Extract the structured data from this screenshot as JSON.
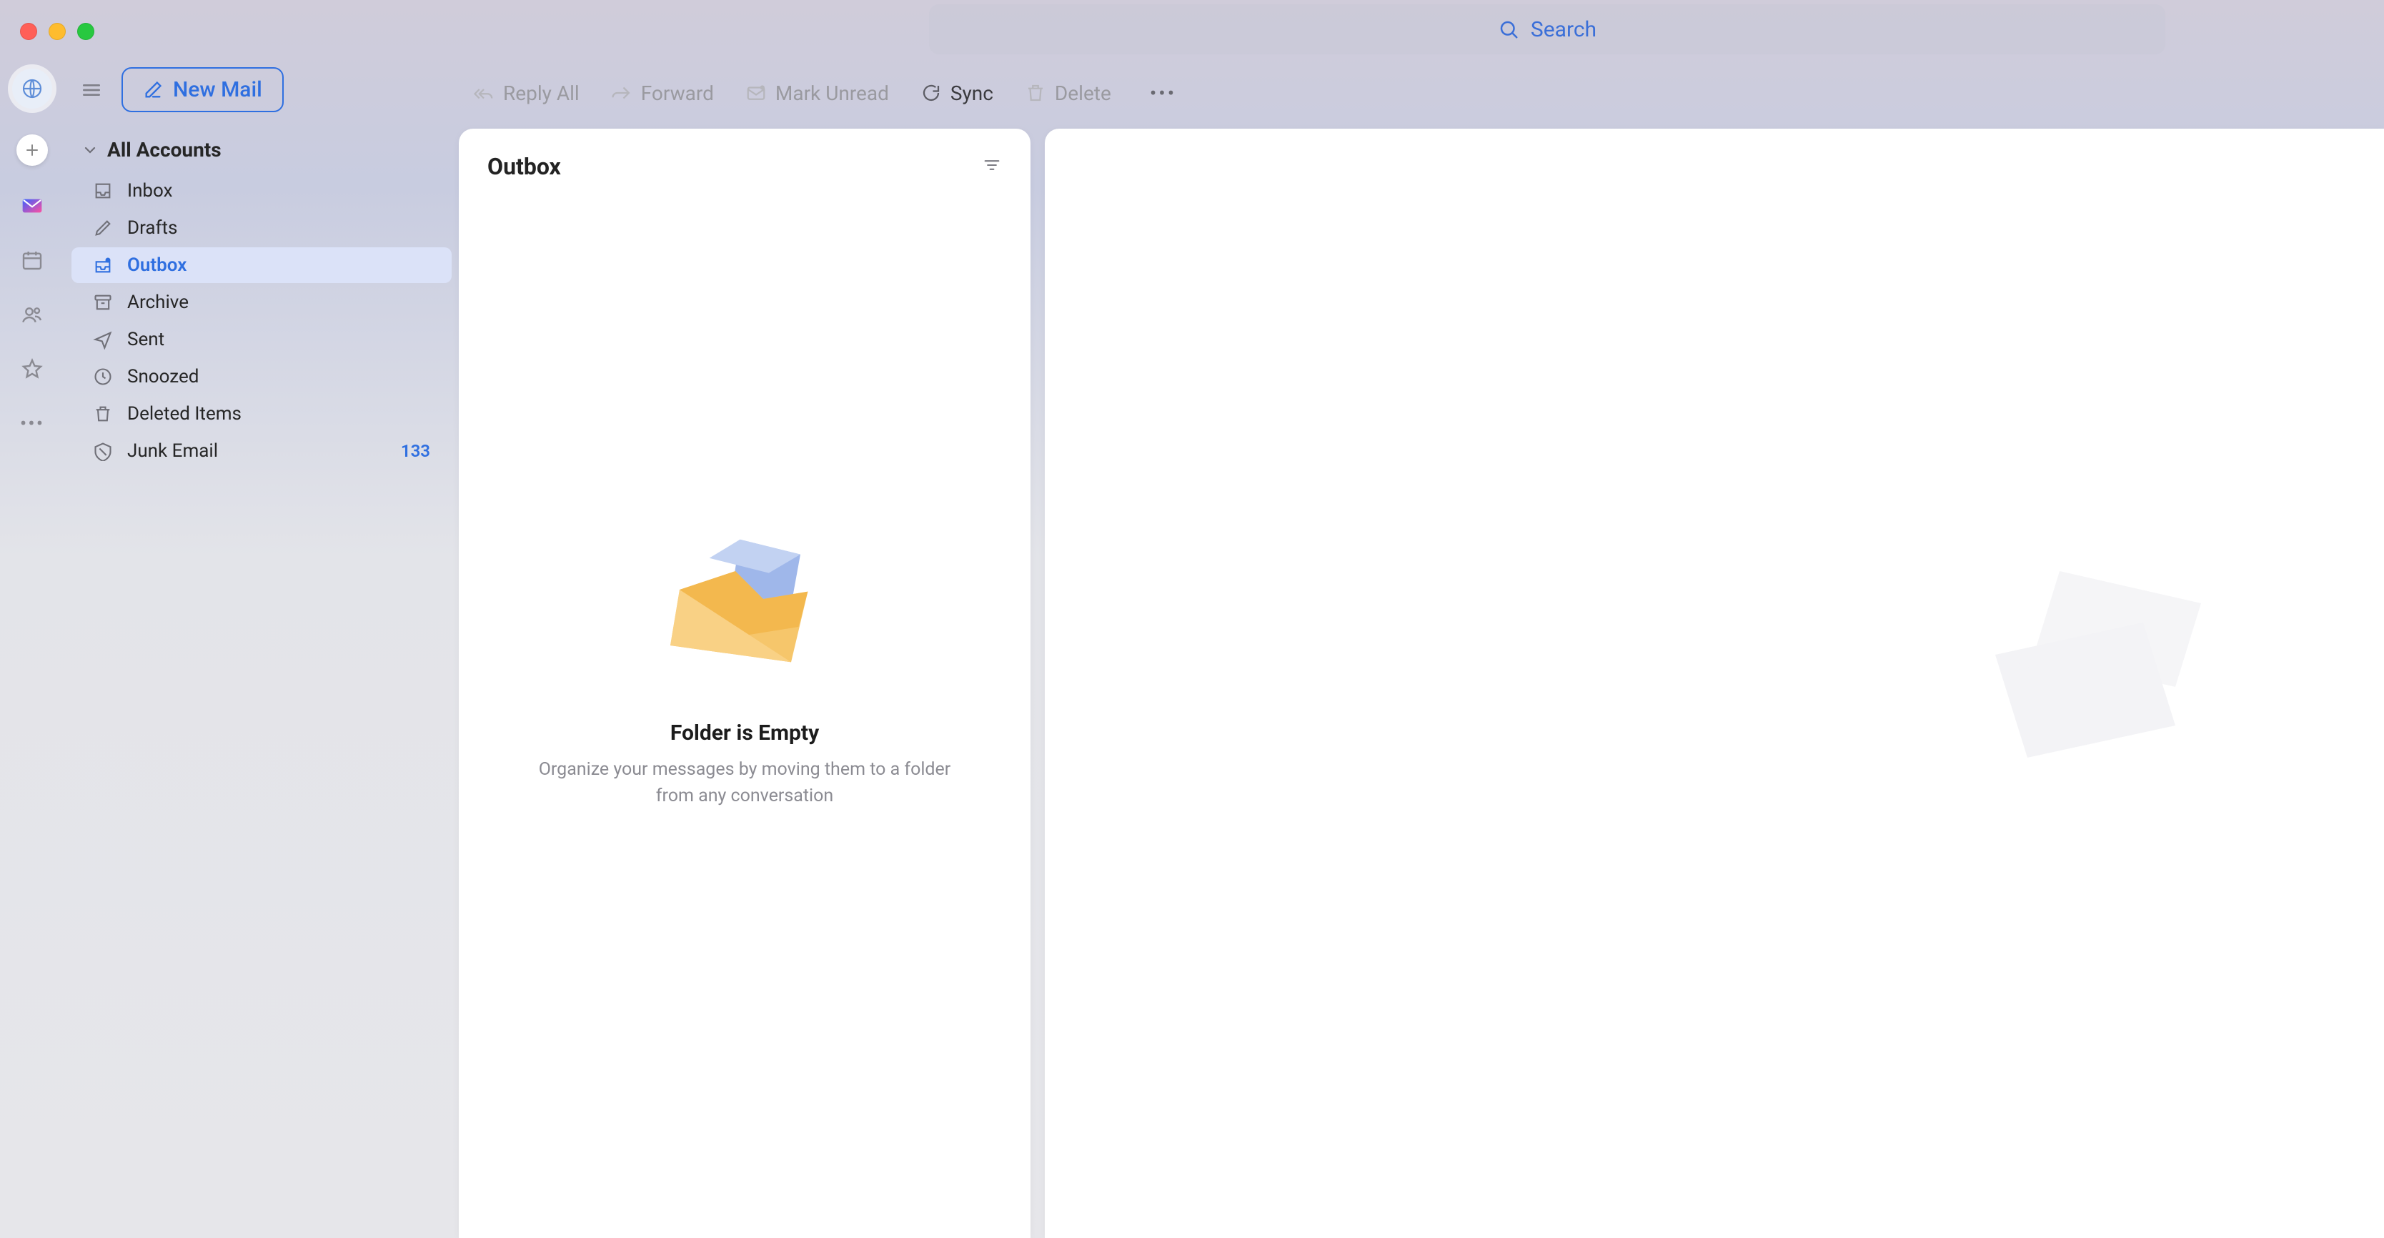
{
  "search": {
    "placeholder": "Search"
  },
  "newMail": {
    "label": "New Mail"
  },
  "accountHeader": {
    "label": "All Accounts"
  },
  "folders": {
    "inbox": "Inbox",
    "drafts": "Drafts",
    "outbox": "Outbox",
    "archive": "Archive",
    "sent": "Sent",
    "snoozed": "Snoozed",
    "deleted": "Deleted Items",
    "junk": "Junk Email",
    "junkCount": "133"
  },
  "toolbar": {
    "replyAll": "Reply All",
    "forward": "Forward",
    "markUnread": "Mark Unread",
    "sync": "Sync",
    "delete": "Delete"
  },
  "listHeader": {
    "title": "Outbox"
  },
  "emptyState": {
    "title": "Folder is Empty",
    "subtitle": "Organize your messages by moving them to a folder from any conversation"
  }
}
